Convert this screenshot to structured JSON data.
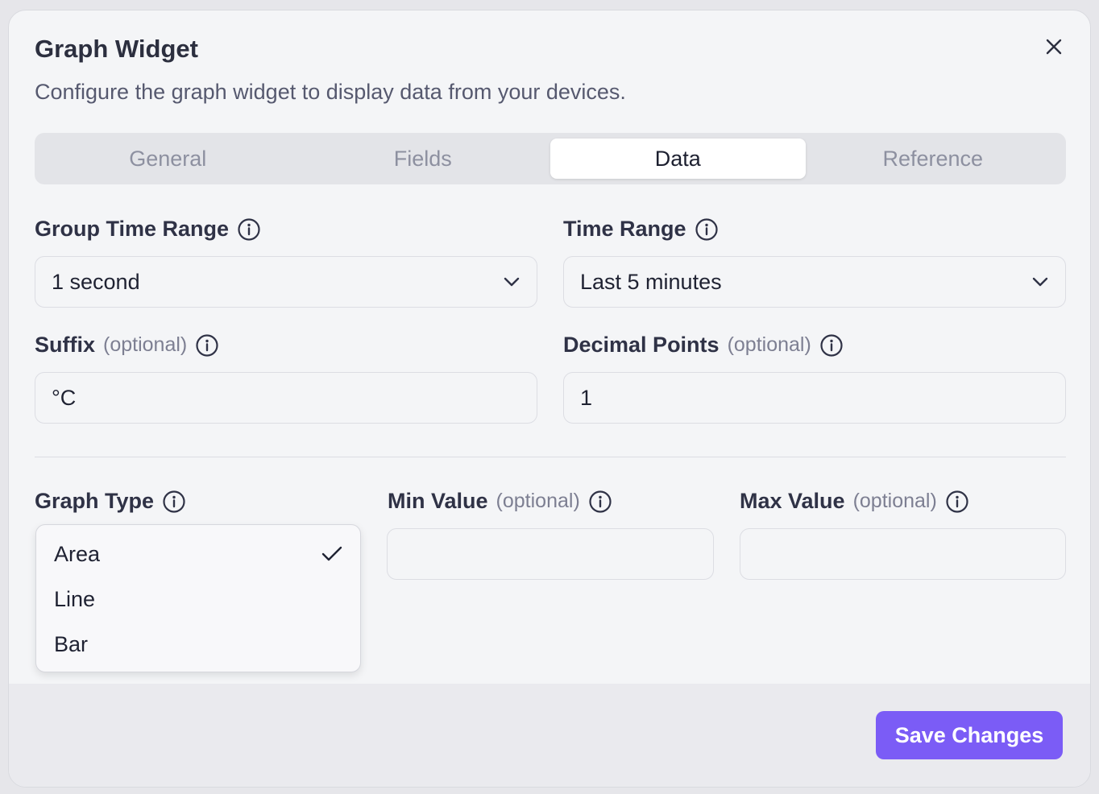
{
  "dialog": {
    "title": "Graph Widget",
    "subtitle": "Configure the graph widget to display data from your devices."
  },
  "tabs": [
    {
      "label": "General",
      "active": false
    },
    {
      "label": "Fields",
      "active": false
    },
    {
      "label": "Data",
      "active": true
    },
    {
      "label": "Reference",
      "active": false
    }
  ],
  "form": {
    "group_time_range": {
      "label": "Group Time Range",
      "value": "1 second"
    },
    "time_range": {
      "label": "Time Range",
      "value": "Last 5 minutes"
    },
    "suffix": {
      "label": "Suffix",
      "optional": "(optional)",
      "value": "°C"
    },
    "decimal_points": {
      "label": "Decimal Points",
      "optional": "(optional)",
      "value": "1"
    },
    "graph_type": {
      "label": "Graph Type",
      "options": [
        "Area",
        "Line",
        "Bar"
      ],
      "selected": "Area"
    },
    "min_value": {
      "label": "Min Value",
      "optional": "(optional)",
      "value": ""
    },
    "max_value": {
      "label": "Max Value",
      "optional": "(optional)",
      "value": ""
    }
  },
  "footer": {
    "save_label": "Save Changes"
  },
  "icons": {
    "close": "close-icon",
    "info": "info-icon",
    "chevron": "chevron-down-icon",
    "check": "check-icon"
  },
  "colors": {
    "accent": "#7b5cf6",
    "background": "#f4f5f7",
    "text": "#2c2f3f"
  }
}
